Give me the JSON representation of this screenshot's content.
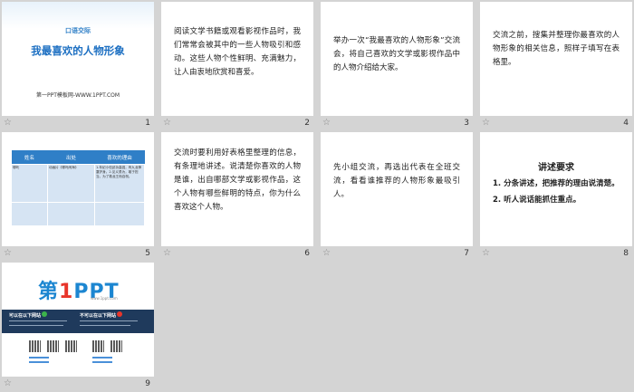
{
  "slides": [
    {
      "num": "1",
      "subtitle": "口语交际",
      "title": "我最喜欢的人物形象",
      "site": "第一PPT模板网-WWW.1PPT.COM"
    },
    {
      "num": "2",
      "text": "阅读文学书籍或观看影视作品时，我们常常会被其中的一些人物吸引和感动。这些人物个性鲜明、充满魅力，让人由衷地欣赏和喜爱。"
    },
    {
      "num": "3",
      "text": "举办一次“我最喜欢的人物形象”交流会，将自己喜欢的文学或影视作品中的人物介绍给大家。"
    },
    {
      "num": "4",
      "text": "交流之前，搜集并整理你最喜欢的人物形象的相关信息，照样子填写在表格里。"
    },
    {
      "num": "5",
      "table": {
        "headers": [
          "姓名",
          "出处",
          "喜欢的理由"
        ],
        "row": [
          "哪吒",
          "动画片《哪吒闹海》",
          "1.年纪小但武功高强，有九龙神罩护身。2.见义勇为，敢于担当，为了救龙王而自刎。"
        ]
      }
    },
    {
      "num": "6",
      "text": "交流时要利用好表格里整理的信息，有条理地讲述。说清楚你喜欢的人物是谁，出自哪部文学或影视作品，这个人物有哪些鲜明的特点，你为什么喜欢这个人物。"
    },
    {
      "num": "7",
      "text": "先小组交流，再选出代表在全班交流，看看谁推荐的人物形象最吸引人。"
    },
    {
      "num": "8",
      "title": "讲述要求",
      "items": [
        "1. 分条讲述，把推荐的理由说清楚。",
        "2. 听人说话能抓住重点。"
      ]
    },
    {
      "num": "9",
      "logo_main": "第",
      "logo_one": "1",
      "logo_rest": "PPT",
      "logo_url": "www.1ppt.com",
      "left_head": "可以在以下网站",
      "right_head": "不可以在以下网站"
    }
  ],
  "star": "☆"
}
